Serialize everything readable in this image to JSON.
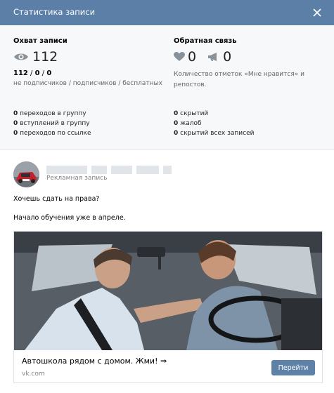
{
  "header": {
    "title": "Статистика записи"
  },
  "reach": {
    "title": "Охват записи",
    "value": "112",
    "breakdown_a": "112",
    "breakdown_sep1": " / ",
    "breakdown_b": "0",
    "breakdown_sep2": " / ",
    "breakdown_c": "0",
    "breakdown_caption": "не подписчиков / подписчиков / бесплатных"
  },
  "feedback": {
    "title": "Обратная связь",
    "likes": "0",
    "shares": "0",
    "caption_line1": "Количество отметок «Мне нравится» и",
    "caption_line2": "репостов."
  },
  "left_stats": [
    {
      "n": "0",
      "label": " переходов в группу"
    },
    {
      "n": "0",
      "label": " вступлений в группу"
    },
    {
      "n": "0",
      "label": " переходов по ссылке"
    }
  ],
  "right_stats": [
    {
      "n": "0",
      "label": " скрытий"
    },
    {
      "n": "0",
      "label": " жалоб"
    },
    {
      "n": "0",
      "label": " скрытий всех записей"
    }
  ],
  "post": {
    "ad_label": "Рекламная запись",
    "text_line1": "Хочешь сдать на права?",
    "text_line2": "Начало обучения уже в апреле.",
    "card_title": "Автошкола рядом с домом. Жми! ⇒",
    "card_domain": "vk.com",
    "button_label": "Перейти"
  },
  "colors": {
    "header": "#5b7fa6",
    "button": "#5e81a8",
    "icon": "#8a9299"
  },
  "icons": [
    "close-icon",
    "eye-icon",
    "heart-icon",
    "megaphone-icon"
  ]
}
